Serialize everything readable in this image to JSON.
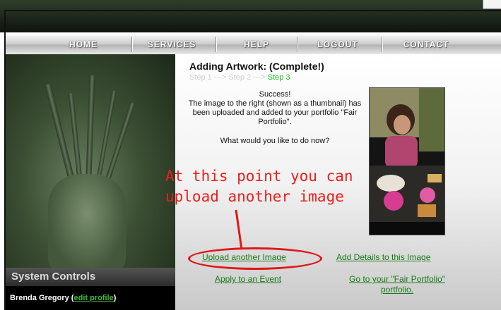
{
  "nav": {
    "items": [
      "HOME",
      "SERVICES",
      "HELP",
      "LOGOUT",
      "CONTACT"
    ]
  },
  "page": {
    "title": "Adding Artwork: (Complete!)",
    "steps": {
      "step1": "Step 1",
      "arrow1": " ---> ",
      "step2": "Step 2",
      "arrow2": " ---> ",
      "step3": "Step 3"
    },
    "message": {
      "heading": "Success!",
      "body": "The image to the right (shown as a thumbnail) has been uploaded and added to your portfolio \"Fair Portfolio\"."
    },
    "question": "What would you like to do now?"
  },
  "annotation": {
    "line1": "At this point you can",
    "line2": "upload another image"
  },
  "actions": {
    "upload_another": "Upload another Image",
    "add_details": "Add Details to this Image",
    "apply_event": "Apply to an Event",
    "go_portfolio": "Go to your \"Fair Portfolio\" portfolio."
  },
  "sidebar": {
    "heading": "System Controls",
    "user_name": "Brenda Gregory",
    "edit_profile": "edit profile"
  },
  "colors": {
    "step_active": "#23c023",
    "link": "#1a7a1a",
    "annotation": "#ee1d1d"
  }
}
